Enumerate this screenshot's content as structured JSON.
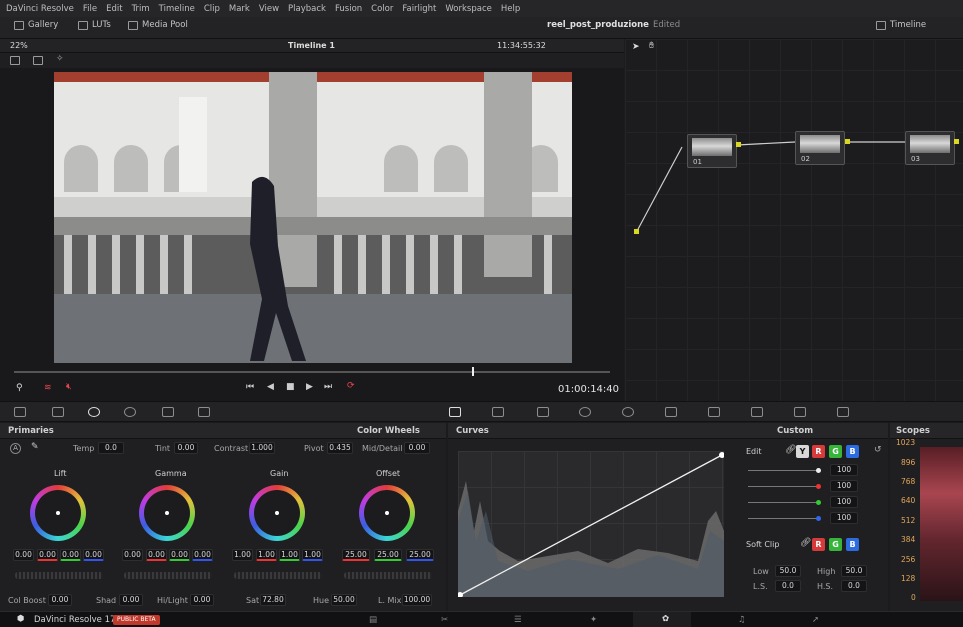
{
  "menu": [
    "DaVinci Resolve",
    "File",
    "Edit",
    "Trim",
    "Timeline",
    "Clip",
    "Mark",
    "View",
    "Playback",
    "Fusion",
    "Color",
    "Fairlight",
    "Workspace",
    "Help"
  ],
  "toolbar": {
    "gallery": "Gallery",
    "luts": "LUTs",
    "media_pool": "Media Pool",
    "project_title": "reel_post_produzione",
    "status": "Edited",
    "timeline": "Timeline"
  },
  "viewer": {
    "zoom": "22%",
    "timeline_name": "Timeline 1",
    "timecode_top": "11:34:55:32",
    "timecode": "01:00:14:40"
  },
  "nodes": [
    {
      "label": "01"
    },
    {
      "label": "02"
    },
    {
      "label": "03"
    }
  ],
  "primaries": {
    "title": "Primaries",
    "mode": "Color Wheels",
    "temp_label": "Temp",
    "temp": "0.0",
    "tint_label": "Tint",
    "tint": "0.00",
    "contrast_label": "Contrast",
    "contrast": "1.000",
    "pivot_label": "Pivot",
    "pivot": "0.435",
    "mid_label": "Mid/Detail",
    "mid": "0.00",
    "wheels": [
      {
        "name": "Lift",
        "values": [
          "0.00",
          "0.00",
          "0.00",
          "0.00"
        ]
      },
      {
        "name": "Gamma",
        "values": [
          "0.00",
          "0.00",
          "0.00",
          "0.00"
        ]
      },
      {
        "name": "Gain",
        "values": [
          "1.00",
          "1.00",
          "1.00",
          "1.00"
        ]
      },
      {
        "name": "Offset",
        "values": [
          "25.00",
          "25.00",
          "25.00"
        ]
      }
    ],
    "bottom": {
      "colboost_label": "Col Boost",
      "colboost": "0.00",
      "shad_label": "Shad",
      "shad": "0.00",
      "hilight_label": "Hi/Light",
      "hilight": "0.00",
      "sat_label": "Sat",
      "sat": "72.80",
      "hue_label": "Hue",
      "hue": "50.00",
      "lmix_label": "L. Mix",
      "lmix": "100.00"
    }
  },
  "curves": {
    "title": "Curves",
    "mode": "Custom",
    "edit_label": "Edit",
    "channels": [
      "Y",
      "R",
      "G",
      "B"
    ],
    "values": [
      "100",
      "100",
      "100",
      "100"
    ],
    "softclip_label": "Soft Clip",
    "low_label": "Low",
    "low": "50.0",
    "high_label": "High",
    "high": "50.0",
    "ls_label": "L.S.",
    "ls": "0.0",
    "hs_label": "H.S.",
    "hs": "0.0"
  },
  "scopes": {
    "title": "Scopes",
    "ticks": [
      "1023",
      "896",
      "768",
      "640",
      "512",
      "384",
      "256",
      "128",
      "0"
    ]
  },
  "status": {
    "app": "DaVinci Resolve 17",
    "badge": "PUBLIC BETA"
  },
  "colors": {
    "accent": "#e8484d",
    "wheel_bg": "#1c1c1e",
    "panel": "#1f1f21"
  }
}
